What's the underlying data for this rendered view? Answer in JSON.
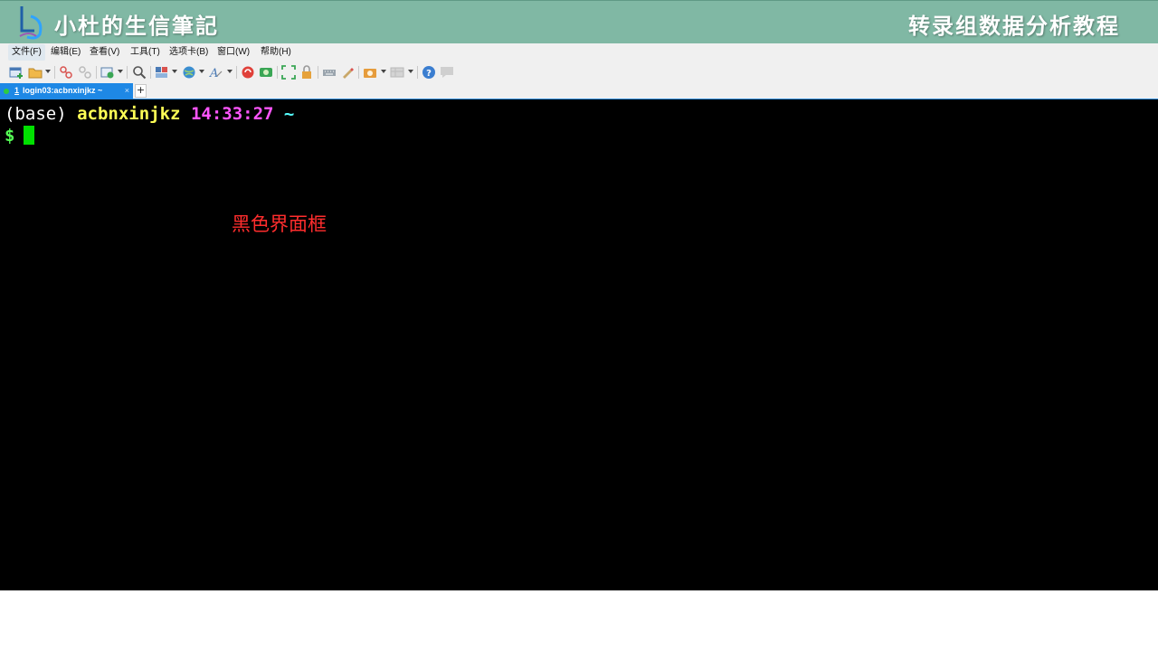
{
  "banner": {
    "brand_title": "小杜的生信筆記",
    "course_title": "转录组数据分析教程"
  },
  "menu": {
    "items": [
      {
        "label": "文件(F)"
      },
      {
        "label": "编辑(E)"
      },
      {
        "label": "查看(V)"
      },
      {
        "label": "工具(T)"
      },
      {
        "label": "选项卡(B)"
      },
      {
        "label": "窗口(W)"
      },
      {
        "label": "帮助(H)"
      }
    ]
  },
  "toolbar": {
    "icons": [
      "new-session-icon",
      "open-folder-icon",
      "connect-icon",
      "disconnect-icon",
      "transfer-icon",
      "find-icon",
      "layout-icon",
      "globe-icon",
      "font-icon",
      "xftp-icon",
      "xshell-plugin-icon",
      "fullscreen-icon",
      "lock-icon",
      "keyboard-icon",
      "highlight-icon",
      "screenshot-icon",
      "compose-icon",
      "help-icon",
      "chat-icon"
    ]
  },
  "tabs": {
    "active": {
      "number": "1",
      "label": "login03:acbnxinjkz ~",
      "close": "×"
    },
    "new_tab": "+"
  },
  "terminal": {
    "env": "(base)",
    "user": "acbnxinjkz",
    "time": "14:33:27",
    "dir": "~",
    "prompt_symbol": "$"
  },
  "annotation": {
    "text": "黑色界面框",
    "color": "#ff2d2d"
  },
  "colors": {
    "banner_bg": "#80b8a4",
    "tab_active": "#1e88e5",
    "terminal_bg": "#000000",
    "cursor": "#00e000"
  }
}
